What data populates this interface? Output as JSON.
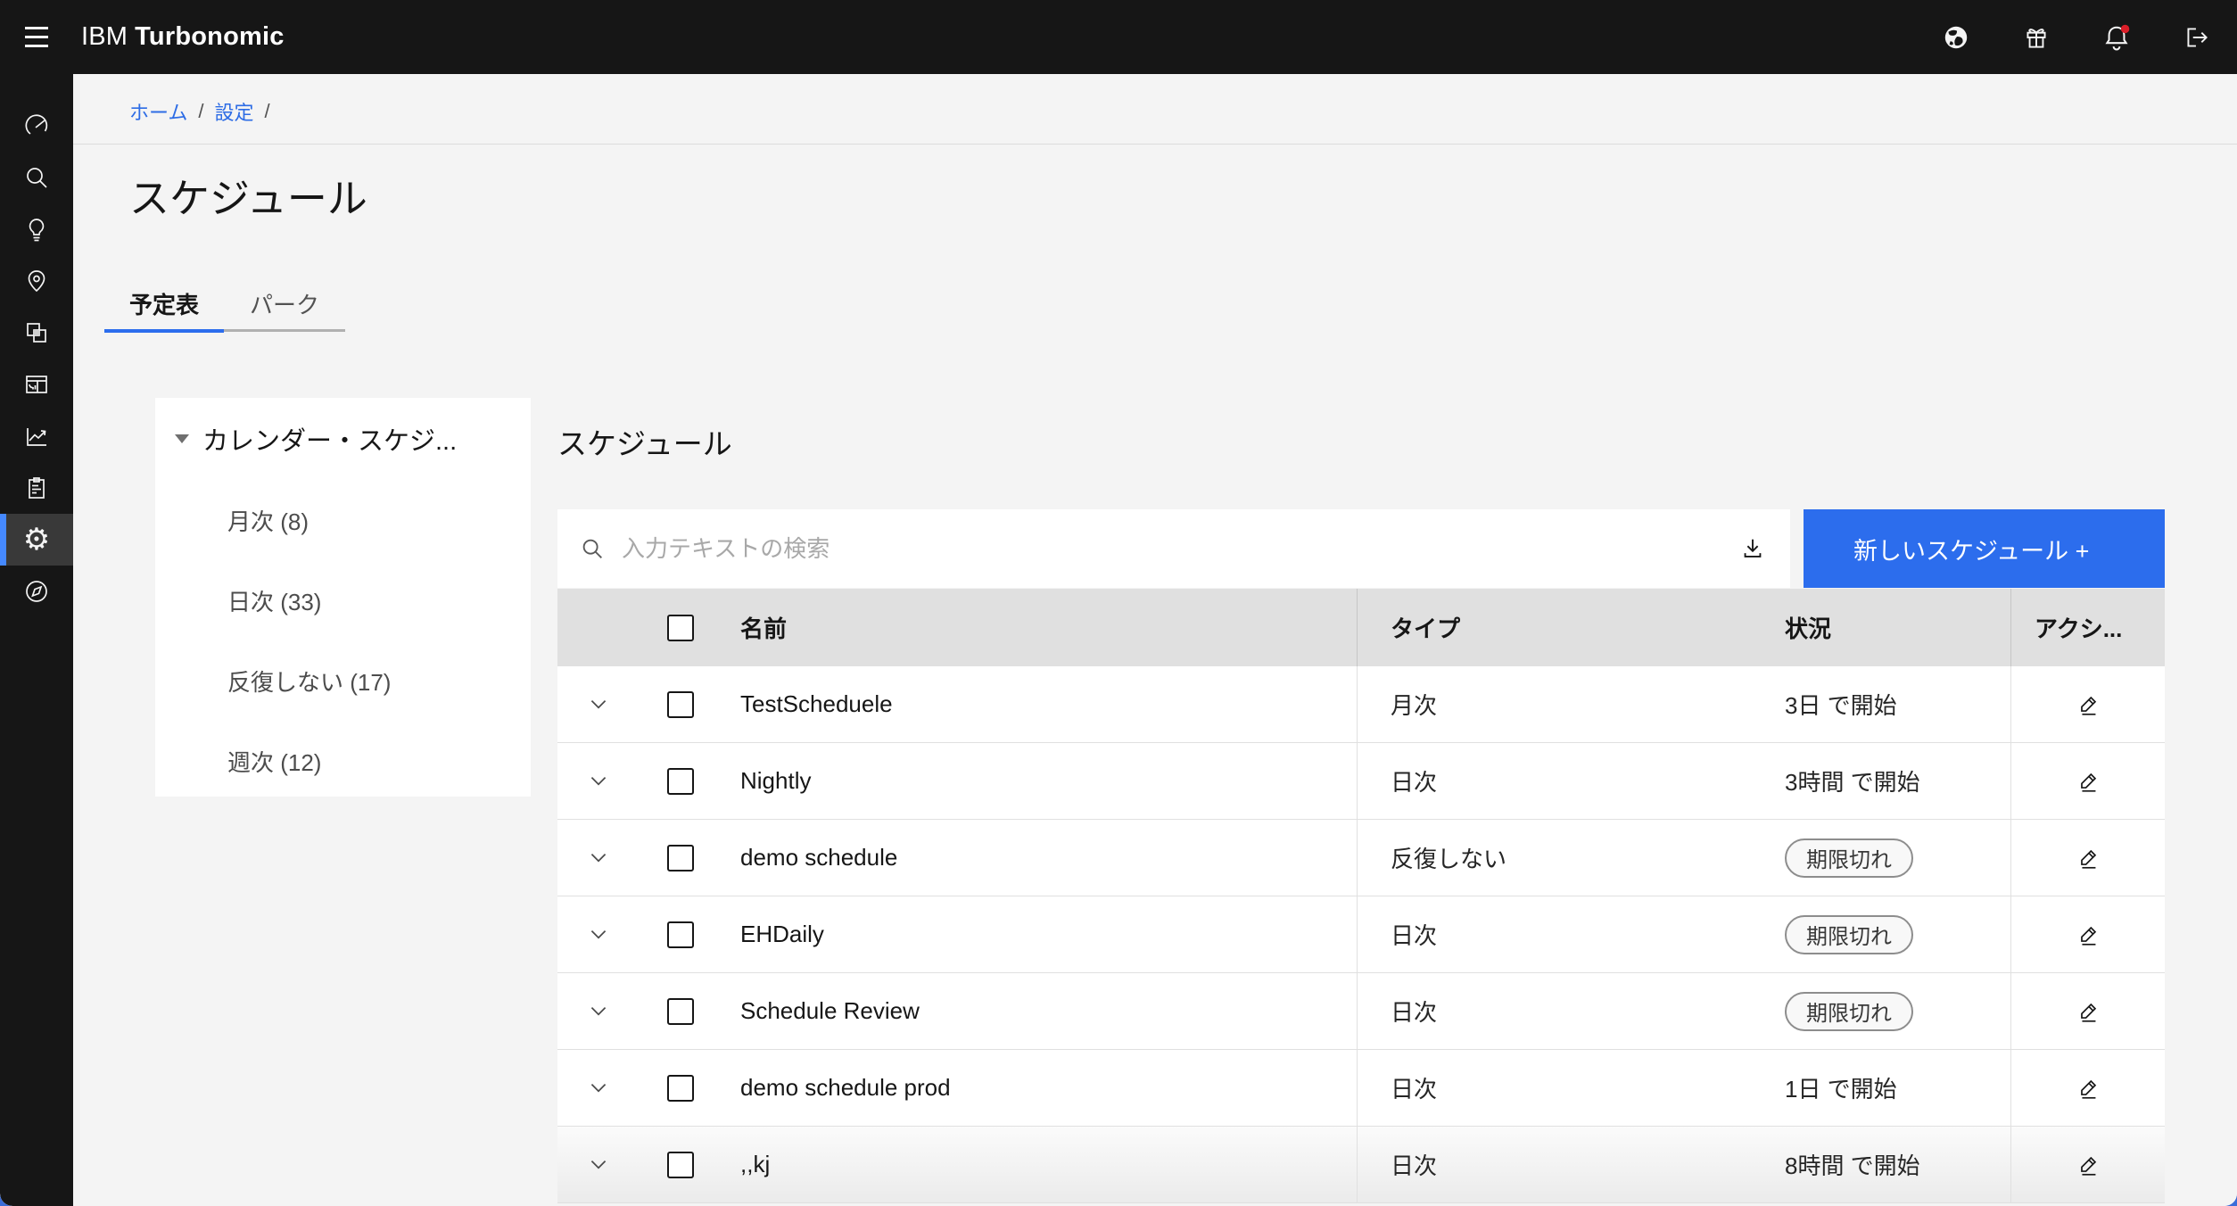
{
  "header": {
    "brand_prefix": "IBM",
    "brand_name": "Turbonomic",
    "icons": [
      "globe-icon",
      "gift-icon",
      "notifications-bell-icon",
      "logout-icon"
    ],
    "notification_dot_color": "#da1e28"
  },
  "sidebar": {
    "items": [
      "gauge",
      "search",
      "lightbulb",
      "location-pin",
      "overlap-squares",
      "dashboard",
      "line-chart",
      "clipboard",
      "settings-gear",
      "compass"
    ],
    "active_item": "settings-gear",
    "active_indicator_color": "#4589ff"
  },
  "breadcrumb": {
    "items": [
      "ホーム",
      "設定"
    ],
    "separator": "/"
  },
  "page": {
    "title": "スケジュール"
  },
  "tabs": [
    {
      "label": "予定表",
      "active": true
    },
    {
      "label": "パーク",
      "active": false
    }
  ],
  "tree": {
    "title": "カレンダー・スケジ...",
    "items": [
      "月次 (8)",
      "日次 (33)",
      "反復しない (17)",
      "週次 (12)"
    ]
  },
  "main": {
    "heading": "スケジュール",
    "search_placeholder": "入力テキストの検索",
    "new_button_label": "新しいスケジュール +"
  },
  "table": {
    "columns": {
      "name": "名前",
      "type": "タイプ",
      "status": "状況",
      "actions": "アクシ..."
    },
    "rows": [
      {
        "name": "TestScheduele",
        "type": "月次",
        "status": "3日 で開始",
        "status_badge": false,
        "highlighted": false
      },
      {
        "name": "Nightly",
        "type": "日次",
        "status": "3時間 で開始",
        "status_badge": false,
        "highlighted": false
      },
      {
        "name": "demo schedule",
        "type": "反復しない",
        "status": "期限切れ",
        "status_badge": true,
        "highlighted": false
      },
      {
        "name": "EHDaily",
        "type": "日次",
        "status": "期限切れ",
        "status_badge": true,
        "highlighted": false
      },
      {
        "name": "Schedule Review",
        "type": "日次",
        "status": "期限切れ",
        "status_badge": true,
        "highlighted": false
      },
      {
        "name": "demo schedule prod",
        "type": "日次",
        "status": "1日 で開始",
        "status_badge": false,
        "highlighted": false
      },
      {
        "name": ",,kj",
        "type": "日次",
        "status": "8時間 で開始",
        "status_badge": false,
        "highlighted": true
      }
    ]
  },
  "colors": {
    "topbar_bg": "#161616",
    "accent_button": "#2c6ded",
    "link_blue": "#2d6ce5",
    "content_bg": "#f4f4f4",
    "table_header_bg": "#e0e0e0",
    "badge_border": "#8d8d8d"
  }
}
